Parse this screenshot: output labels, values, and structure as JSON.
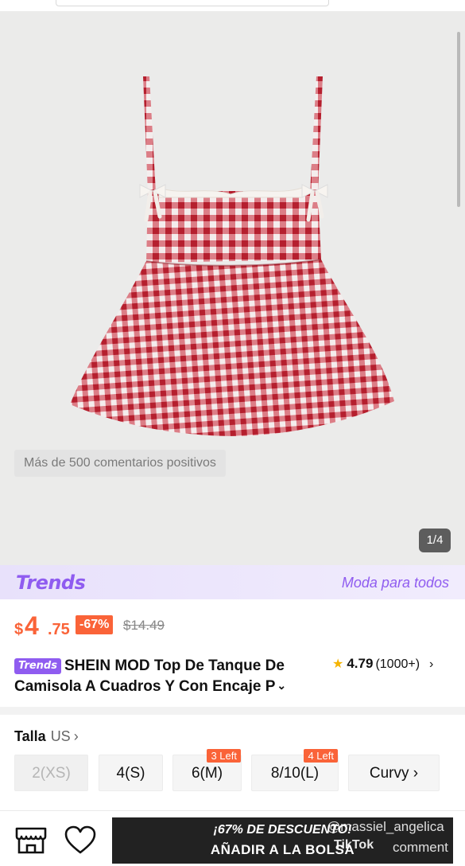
{
  "gallery": {
    "badge_text": "Más de 500 comentarios positivos",
    "page_counter": "1/4",
    "fabric_colors": {
      "red": "#b51f2e",
      "white": "#f4eded",
      "lace": "#f6f3ef"
    }
  },
  "trends_banner": {
    "logo": "Trends",
    "tagline": "Moda para todos",
    "color": "#8f5cf0"
  },
  "price": {
    "currency": "$",
    "integer": "4",
    "decimal": ".75",
    "discount": "-67%",
    "original": "$14.49",
    "accent_color": "#fa6338"
  },
  "product": {
    "tag": "Trends",
    "title_line1": "SHEIN MOD Top De Tanque De",
    "title_line2": "Camisola A Cuadros Y Con Encaje P",
    "rating_score": "4.79",
    "rating_count": "(1000+)"
  },
  "size": {
    "label": "Talla",
    "unit": "US",
    "options": [
      {
        "label": "2(XS)",
        "badge": ""
      },
      {
        "label": "4(S)",
        "badge": ""
      },
      {
        "label": "6(M)",
        "badge": "3 Left"
      },
      {
        "label": "8/10(L)",
        "badge": "4 Left"
      },
      {
        "label": "Curvy",
        "badge": ""
      }
    ]
  },
  "bottom_bar": {
    "promo": "¡67% DE DESCUENTO!",
    "cart_label": "AÑADIR A LA BOLSA"
  },
  "overlay": {
    "username": "@massiel_angelica",
    "brand": "TikTok",
    "comment": "comment"
  }
}
